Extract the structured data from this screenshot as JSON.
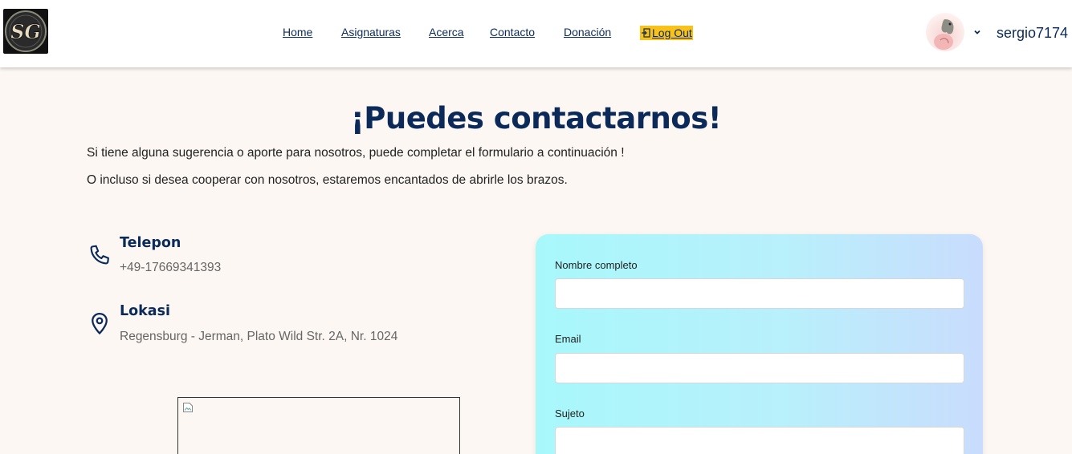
{
  "nav": {
    "logo_text": "SG",
    "links": [
      "Home",
      "Asignaturas",
      "Acerca",
      "Contacto",
      "Donación"
    ],
    "logout_label": "Log Out",
    "username": "sergio7174"
  },
  "main": {
    "title": "¡Puedes contactarnos!",
    "intro_1": "Si tiene alguna sugerencia o aporte para nosotros, puede completar el formulario a continuación !",
    "intro_2": "O incluso si desea cooperar con nosotros, estaremos encantados de abrirle los brazos."
  },
  "contact_info": {
    "phone_title": "Telepon",
    "phone_value": "+49-17669341393",
    "location_title": "Lokasi",
    "location_value": "Regensburg - Jerman, Plato Wild Str. 2A, Nr. 1024"
  },
  "form": {
    "name_label": "Nombre completo",
    "name_value": "",
    "email_label": "Email",
    "email_value": "",
    "subject_label": "Sujeto",
    "subject_value": ""
  },
  "colors": {
    "brand_navy": "#0b2a5a",
    "logout_bg": "#f8c21b",
    "page_bg": "#fcf7f2",
    "form_gradient_start": "#a8f8fb",
    "form_gradient_end": "#c9dcfd"
  },
  "icons": [
    "logo-icon",
    "logout-icon",
    "avatar-icon",
    "chevron-down-icon",
    "phone-icon",
    "location-pin-icon",
    "broken-image-icon"
  ]
}
